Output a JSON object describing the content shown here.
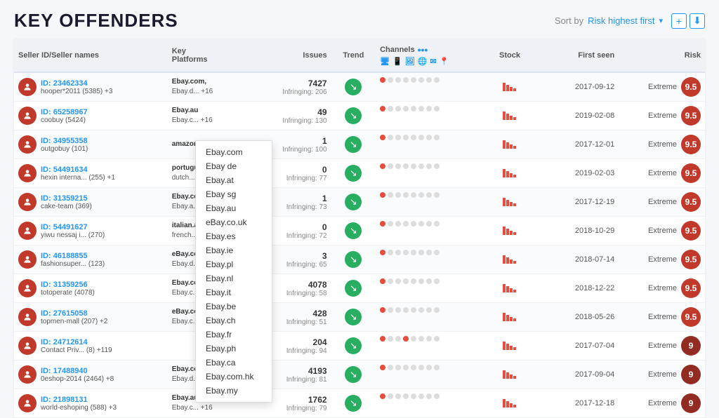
{
  "header": {
    "title": "KEY OFFENDERS",
    "sort_label": "Sort by",
    "sort_value": "Risk highest first",
    "add_icon": "+",
    "download_icon": "⬇"
  },
  "table": {
    "columns": [
      {
        "key": "seller",
        "label": "Seller ID/Seller names"
      },
      {
        "key": "platforms",
        "label": "Key\nPlatforms"
      },
      {
        "key": "issues",
        "label": "Issues"
      },
      {
        "key": "trend",
        "label": "Trend"
      },
      {
        "key": "channels",
        "label": "Channels"
      },
      {
        "key": "stock",
        "label": "Stock"
      },
      {
        "key": "first_seen",
        "label": "First seen"
      },
      {
        "key": "risk",
        "label": "Risk"
      }
    ],
    "rows": [
      {
        "id": "ID: 23462334",
        "name": "hooper*2011 (5385) +3",
        "platforms": [
          "Ebay.com,",
          "Ebay.d... +16"
        ],
        "issues_count": "7427",
        "issues_infringing": "Infringing: 206",
        "first_seen": "2017-09-12",
        "risk_label": "Extreme",
        "risk_score": "9.5",
        "risk_class": "risk-extreme",
        "dots": [
          1,
          0,
          0,
          0,
          0,
          0,
          0,
          0
        ]
      },
      {
        "id": "ID: 65258967",
        "name": "coobuy (5424)",
        "platforms": [
          "Ebay.au",
          "Ebay.c... +16"
        ],
        "issues_count": "49",
        "issues_infringing": "Infringing: 130",
        "first_seen": "2019-02-08",
        "risk_label": "Extreme",
        "risk_score": "9.5",
        "risk_class": "risk-extreme",
        "dots": [
          1,
          0,
          0,
          0,
          0,
          0,
          0,
          0
        ]
      },
      {
        "id": "ID: 34955358",
        "name": "outgobuy (101)",
        "platforms": [
          "amazon..."
        ],
        "issues_count": "1",
        "issues_infringing": "Infringing: 100",
        "first_seen": "2017-12-01",
        "risk_label": "Extreme",
        "risk_score": "9.5",
        "risk_class": "risk-extreme",
        "dots": [
          1,
          0,
          0,
          0,
          0,
          0,
          0,
          0
        ]
      },
      {
        "id": "ID: 54491634",
        "name": "hexin interna... (255) +1",
        "platforms": [
          "portugue...",
          "dutch..."
        ],
        "issues_count": "0",
        "issues_infringing": "Infringing: 77",
        "first_seen": "2019-02-03",
        "risk_label": "Extreme",
        "risk_score": "9.5",
        "risk_class": "risk-extreme",
        "dots": [
          1,
          0,
          0,
          0,
          0,
          0,
          0,
          0
        ]
      },
      {
        "id": "ID: 31359215",
        "name": "cake-team (369)",
        "platforms": [
          "Ebay.com,",
          "Ebay.a... +16"
        ],
        "issues_count": "1",
        "issues_infringing": "Infringing: 73",
        "first_seen": "2017-12-19",
        "risk_label": "Extreme",
        "risk_score": "9.5",
        "risk_class": "risk-extreme",
        "dots": [
          1,
          0,
          0,
          0,
          0,
          0,
          0,
          0
        ]
      },
      {
        "id": "ID: 54491627",
        "name": "yiwu nessaj i... (270)",
        "platforms": [
          "italian.a...",
          "french..."
        ],
        "issues_count": "0",
        "issues_infringing": "Infringing: 72",
        "first_seen": "2018-10-29",
        "risk_label": "Extreme",
        "risk_score": "9.5",
        "risk_class": "risk-extreme",
        "dots": [
          1,
          0,
          0,
          0,
          0,
          0,
          0,
          0
        ]
      },
      {
        "id": "ID: 46188855",
        "name": "fashionsuper... (123)",
        "platforms": [
          "eBay.co...",
          "Ebay.d... +16"
        ],
        "issues_count": "3",
        "issues_infringing": "Infringing: 65",
        "first_seen": "2018-07-14",
        "risk_label": "Extreme",
        "risk_score": "9.5",
        "risk_class": "risk-extreme",
        "dots": [
          1,
          0,
          0,
          0,
          0,
          0,
          0,
          0
        ]
      },
      {
        "id": "ID: 31359256",
        "name": "totoperate (4078)",
        "platforms": [
          "Ebay.com,",
          "Ebay.c... +16"
        ],
        "issues_count": "4078",
        "issues_infringing": "Infringing: 58",
        "first_seen": "2018-12-22",
        "risk_label": "Extreme",
        "risk_score": "9.5",
        "risk_class": "risk-extreme",
        "dots": [
          1,
          0,
          0,
          0,
          0,
          0,
          0,
          0
        ]
      },
      {
        "id": "ID: 27615058",
        "name": "topmen-mall (207) +2",
        "platforms": [
          "eBay.co.uk",
          "Ebay.c... +15"
        ],
        "issues_count": "428",
        "issues_infringing": "Infringing: 51",
        "first_seen": "2018-05-26",
        "risk_label": "Extreme",
        "risk_score": "9.5",
        "risk_class": "risk-extreme",
        "dots": [
          1,
          0,
          0,
          0,
          0,
          0,
          0,
          0
        ]
      },
      {
        "id": "ID: 24712614",
        "name": "Contact Priv... (8) +119",
        "platforms": [],
        "issues_count": "204",
        "issues_infringing": "Infringing: 94",
        "first_seen": "2017-07-04",
        "risk_label": "Extreme",
        "risk_score": "9",
        "risk_class": "risk-high",
        "dots": [
          1,
          0,
          0,
          1,
          0,
          0,
          0,
          0
        ]
      },
      {
        "id": "ID: 17488940",
        "name": "0eshop-2014 (2464) +8",
        "platforms": [
          "Ebay.com,",
          "Ebay.d... +16"
        ],
        "issues_count": "4193",
        "issues_infringing": "Infringing: 81",
        "first_seen": "2017-09-04",
        "risk_label": "Extreme",
        "risk_score": "9",
        "risk_class": "risk-high",
        "dots": [
          1,
          0,
          0,
          0,
          0,
          0,
          0,
          0
        ]
      },
      {
        "id": "ID: 21898131",
        "name": "world-eshoping (588) +3",
        "platforms": [
          "Ebay.au",
          "Ebay.c... +16"
        ],
        "issues_count": "1762",
        "issues_infringing": "Infringing: 79",
        "first_seen": "2017-12-18",
        "risk_label": "Extreme",
        "risk_score": "9",
        "risk_class": "risk-high",
        "dots": [
          1,
          0,
          0,
          0,
          0,
          0,
          0,
          0
        ]
      }
    ]
  },
  "dropdown": {
    "items": [
      "Ebay.com",
      "Ebay de",
      "Ebay.at",
      "Ebay sg",
      "Ebay.au",
      "eBay.co.uk",
      "Ebay.es",
      "Ebay.ie",
      "Ebay.pl",
      "Ebay.nl",
      "Ebay.it",
      "Ebay.be",
      "Ebay.ch",
      "Ebay.fr",
      "Ebay.ph",
      "Ebay.ca",
      "Ebay.com.hk",
      "Ebay.my"
    ]
  },
  "channel_header_icons": [
    "🖥",
    "📱",
    "🖼",
    "🌐",
    "✉",
    "📍"
  ]
}
